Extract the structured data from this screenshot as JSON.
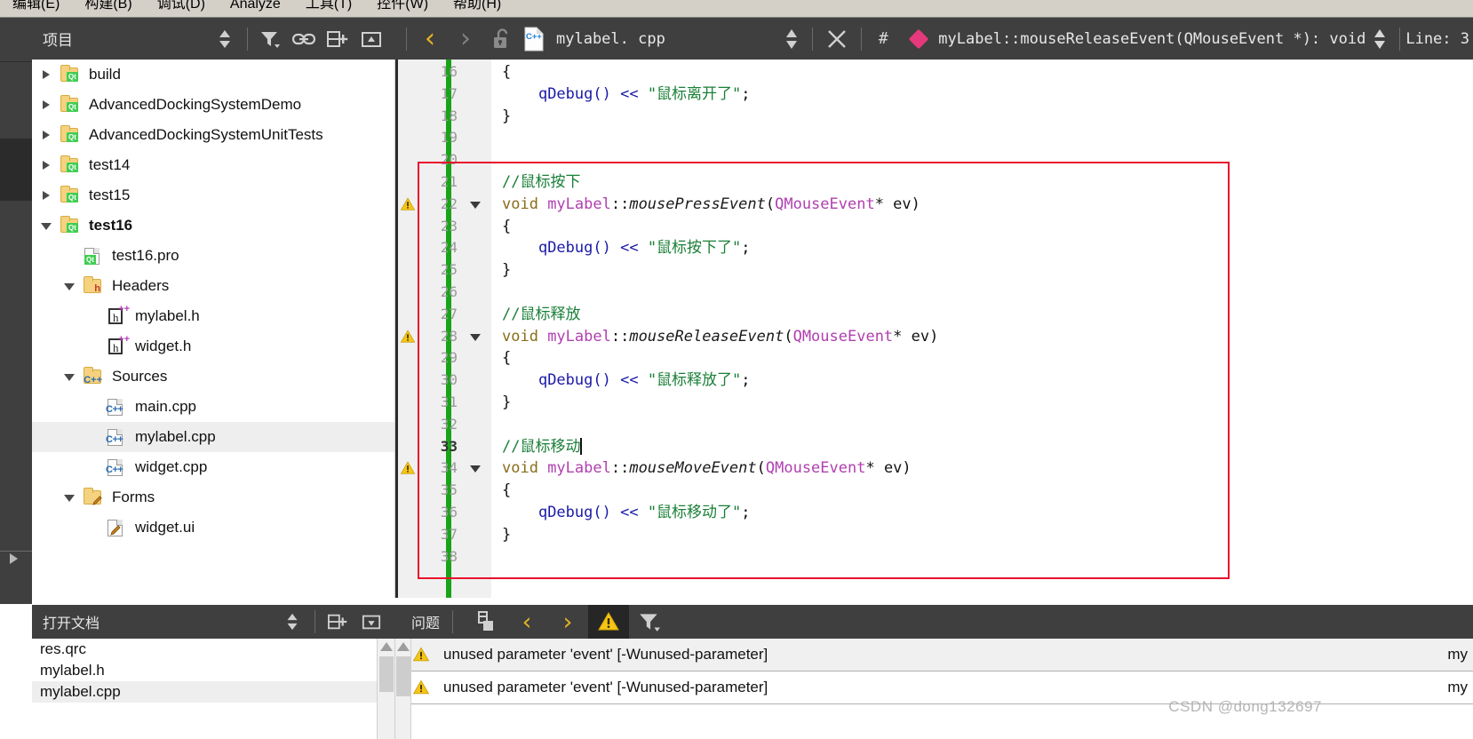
{
  "menubar": {
    "items": [
      {
        "label": "编辑(E)"
      },
      {
        "label": "构建(B)"
      },
      {
        "label": "调试(D)"
      },
      {
        "label": "Analyze"
      },
      {
        "label": "工具(T)"
      },
      {
        "label": "控件(W)"
      },
      {
        "label": "帮助(H)"
      }
    ]
  },
  "project_panel": {
    "title": "项目",
    "tools": [
      "sort-icon",
      "filter-icon",
      "link-icon",
      "split-add-icon",
      "collapse-icon"
    ],
    "tree": [
      {
        "label": "build",
        "indent": 0,
        "twisty": "right",
        "icon": "qt-folder-icon",
        "bold": false,
        "selected": false
      },
      {
        "label": "AdvancedDockingSystemDemo",
        "indent": 0,
        "twisty": "right",
        "icon": "qt-folder-icon",
        "bold": false,
        "selected": false
      },
      {
        "label": "AdvancedDockingSystemUnitTests",
        "indent": 0,
        "twisty": "right",
        "icon": "qt-folder-icon",
        "bold": false,
        "selected": false
      },
      {
        "label": "test14",
        "indent": 0,
        "twisty": "right",
        "icon": "qt-folder-icon",
        "bold": false,
        "selected": false
      },
      {
        "label": "test15",
        "indent": 0,
        "twisty": "right",
        "icon": "qt-folder-icon",
        "bold": false,
        "selected": false
      },
      {
        "label": "test16",
        "indent": 0,
        "twisty": "down",
        "icon": "qt-folder-icon",
        "bold": true,
        "selected": false
      },
      {
        "label": "test16.pro",
        "indent": 1,
        "twisty": "none",
        "icon": "qt-file-icon",
        "bold": false,
        "selected": false
      },
      {
        "label": "Headers",
        "indent": 1,
        "twisty": "down",
        "icon": "h-folder-icon",
        "bold": false,
        "selected": false
      },
      {
        "label": "mylabel.h",
        "indent": 2,
        "twisty": "none",
        "icon": "hpp-file-icon",
        "bold": false,
        "selected": false
      },
      {
        "label": "widget.h",
        "indent": 2,
        "twisty": "none",
        "icon": "hpp-file-icon",
        "bold": false,
        "selected": false
      },
      {
        "label": "Sources",
        "indent": 1,
        "twisty": "down",
        "icon": "cpp-folder-icon",
        "bold": false,
        "selected": false
      },
      {
        "label": "main.cpp",
        "indent": 2,
        "twisty": "none",
        "icon": "cpp-file-icon",
        "bold": false,
        "selected": false
      },
      {
        "label": "mylabel.cpp",
        "indent": 2,
        "twisty": "none",
        "icon": "cpp-file-icon",
        "bold": false,
        "selected": true
      },
      {
        "label": "widget.cpp",
        "indent": 2,
        "twisty": "none",
        "icon": "cpp-file-icon",
        "bold": false,
        "selected": false
      },
      {
        "label": "Forms",
        "indent": 1,
        "twisty": "down",
        "icon": "form-folder-icon",
        "bold": false,
        "selected": false
      },
      {
        "label": "widget.ui",
        "indent": 2,
        "twisty": "none",
        "icon": "ui-file-icon",
        "bold": false,
        "selected": false
      }
    ]
  },
  "editor_toolbar": {
    "back_label": "‹",
    "forward_label": "›",
    "filename": "mylabel. cpp",
    "close_label": "×",
    "hash_label": "#",
    "symbol": "myLabel::mouseReleaseEvent(QMouseEvent *): void",
    "line_label": "Line: 3"
  },
  "editor": {
    "current_line": 33,
    "lines": [
      {
        "n": 16,
        "warn": false,
        "fold": false,
        "tokens": [
          {
            "t": "{",
            "c": "k-plain"
          }
        ]
      },
      {
        "n": 17,
        "warn": false,
        "fold": false,
        "tokens": [
          {
            "t": "    ",
            "c": "k-plain"
          },
          {
            "t": "qDebug",
            "c": "k-call"
          },
          {
            "t": "() ",
            "c": "k-call"
          },
          {
            "t": "<< ",
            "c": "k-op"
          },
          {
            "t": "\"鼠标离开了\"",
            "c": "k-str"
          },
          {
            "t": ";",
            "c": "k-plain"
          }
        ]
      },
      {
        "n": 18,
        "warn": false,
        "fold": false,
        "tokens": [
          {
            "t": "}",
            "c": "k-plain"
          }
        ]
      },
      {
        "n": 19,
        "warn": false,
        "fold": false,
        "tokens": []
      },
      {
        "n": 20,
        "warn": false,
        "fold": false,
        "tokens": []
      },
      {
        "n": 21,
        "warn": false,
        "fold": false,
        "tokens": [
          {
            "t": "//鼠标按下",
            "c": "k-cmt"
          }
        ]
      },
      {
        "n": 22,
        "warn": true,
        "fold": true,
        "tokens": [
          {
            "t": "void ",
            "c": "k-void"
          },
          {
            "t": "myLabel",
            "c": "k-cls"
          },
          {
            "t": "::",
            "c": "k-plain"
          },
          {
            "t": "mousePressEvent",
            "c": "k-fn"
          },
          {
            "t": "(",
            "c": "k-plain"
          },
          {
            "t": "QMouseEvent",
            "c": "k-type"
          },
          {
            "t": "* ev)",
            "c": "k-plain"
          }
        ]
      },
      {
        "n": 23,
        "warn": false,
        "fold": false,
        "tokens": [
          {
            "t": "{",
            "c": "k-plain"
          }
        ]
      },
      {
        "n": 24,
        "warn": false,
        "fold": false,
        "tokens": [
          {
            "t": "    ",
            "c": "k-plain"
          },
          {
            "t": "qDebug",
            "c": "k-call"
          },
          {
            "t": "() ",
            "c": "k-call"
          },
          {
            "t": "<< ",
            "c": "k-op"
          },
          {
            "t": "\"鼠标按下了\"",
            "c": "k-str"
          },
          {
            "t": ";",
            "c": "k-plain"
          }
        ]
      },
      {
        "n": 25,
        "warn": false,
        "fold": false,
        "tokens": [
          {
            "t": "}",
            "c": "k-plain"
          }
        ]
      },
      {
        "n": 26,
        "warn": false,
        "fold": false,
        "tokens": []
      },
      {
        "n": 27,
        "warn": false,
        "fold": false,
        "tokens": [
          {
            "t": "//鼠标释放",
            "c": "k-cmt"
          }
        ]
      },
      {
        "n": 28,
        "warn": true,
        "fold": true,
        "tokens": [
          {
            "t": "void ",
            "c": "k-void"
          },
          {
            "t": "myLabel",
            "c": "k-cls"
          },
          {
            "t": "::",
            "c": "k-plain"
          },
          {
            "t": "mouseReleaseEvent",
            "c": "k-fn"
          },
          {
            "t": "(",
            "c": "k-plain"
          },
          {
            "t": "QMouseEvent",
            "c": "k-type"
          },
          {
            "t": "* ev)",
            "c": "k-plain"
          }
        ]
      },
      {
        "n": 29,
        "warn": false,
        "fold": false,
        "tokens": [
          {
            "t": "{",
            "c": "k-plain"
          }
        ]
      },
      {
        "n": 30,
        "warn": false,
        "fold": false,
        "tokens": [
          {
            "t": "    ",
            "c": "k-plain"
          },
          {
            "t": "qDebug",
            "c": "k-call"
          },
          {
            "t": "() ",
            "c": "k-call"
          },
          {
            "t": "<< ",
            "c": "k-op"
          },
          {
            "t": "\"鼠标释放了\"",
            "c": "k-str"
          },
          {
            "t": ";",
            "c": "k-plain"
          }
        ]
      },
      {
        "n": 31,
        "warn": false,
        "fold": false,
        "tokens": [
          {
            "t": "}",
            "c": "k-plain"
          }
        ]
      },
      {
        "n": 32,
        "warn": false,
        "fold": false,
        "tokens": []
      },
      {
        "n": 33,
        "warn": false,
        "fold": false,
        "caret": true,
        "tokens": [
          {
            "t": "//鼠标移动",
            "c": "k-cmt"
          }
        ]
      },
      {
        "n": 34,
        "warn": true,
        "fold": true,
        "tokens": [
          {
            "t": "void ",
            "c": "k-void"
          },
          {
            "t": "myLabel",
            "c": "k-cls"
          },
          {
            "t": "::",
            "c": "k-plain"
          },
          {
            "t": "mouseMoveEvent",
            "c": "k-fn"
          },
          {
            "t": "(",
            "c": "k-plain"
          },
          {
            "t": "QMouseEvent",
            "c": "k-type"
          },
          {
            "t": "* ev)",
            "c": "k-plain"
          }
        ]
      },
      {
        "n": 35,
        "warn": false,
        "fold": false,
        "tokens": [
          {
            "t": "{",
            "c": "k-plain"
          }
        ]
      },
      {
        "n": 36,
        "warn": false,
        "fold": false,
        "tokens": [
          {
            "t": "    ",
            "c": "k-plain"
          },
          {
            "t": "qDebug",
            "c": "k-call"
          },
          {
            "t": "() ",
            "c": "k-call"
          },
          {
            "t": "<< ",
            "c": "k-op"
          },
          {
            "t": "\"鼠标移动了\"",
            "c": "k-str"
          },
          {
            "t": ";",
            "c": "k-plain"
          }
        ]
      },
      {
        "n": 37,
        "warn": false,
        "fold": false,
        "tokens": [
          {
            "t": "}",
            "c": "k-plain"
          }
        ]
      },
      {
        "n": 38,
        "warn": false,
        "fold": false,
        "tokens": []
      }
    ]
  },
  "open_documents": {
    "title": "打开文档",
    "tools": [
      "sort-icon",
      "split-add-icon",
      "collapse-icon"
    ],
    "items": [
      {
        "label": "mylabel.cpp",
        "selected": true
      },
      {
        "label": "mylabel.h",
        "selected": false
      },
      {
        "label": "res.qrc",
        "selected": false
      }
    ]
  },
  "issues": {
    "title": "问题",
    "tools": [
      "copy-icon",
      "prev-icon",
      "next-icon",
      "warning-filter-icon",
      "filter-icon"
    ],
    "rows": [
      {
        "icon": "warning-icon",
        "text": "unused parameter 'event' [-Wunused-parameter]",
        "right": "my"
      },
      {
        "icon": "warning-icon",
        "text": "unused parameter 'event' [-Wunused-parameter]",
        "right": "my"
      }
    ]
  },
  "watermark": "CSDN @dong132697",
  "colors": {
    "panel_dark": "#3f3f3f",
    "accent_yellow": "#e6b422",
    "annotation_red": "#e8112d",
    "change_bar_green": "#19a319",
    "symbol_pink": "#e6397d"
  }
}
